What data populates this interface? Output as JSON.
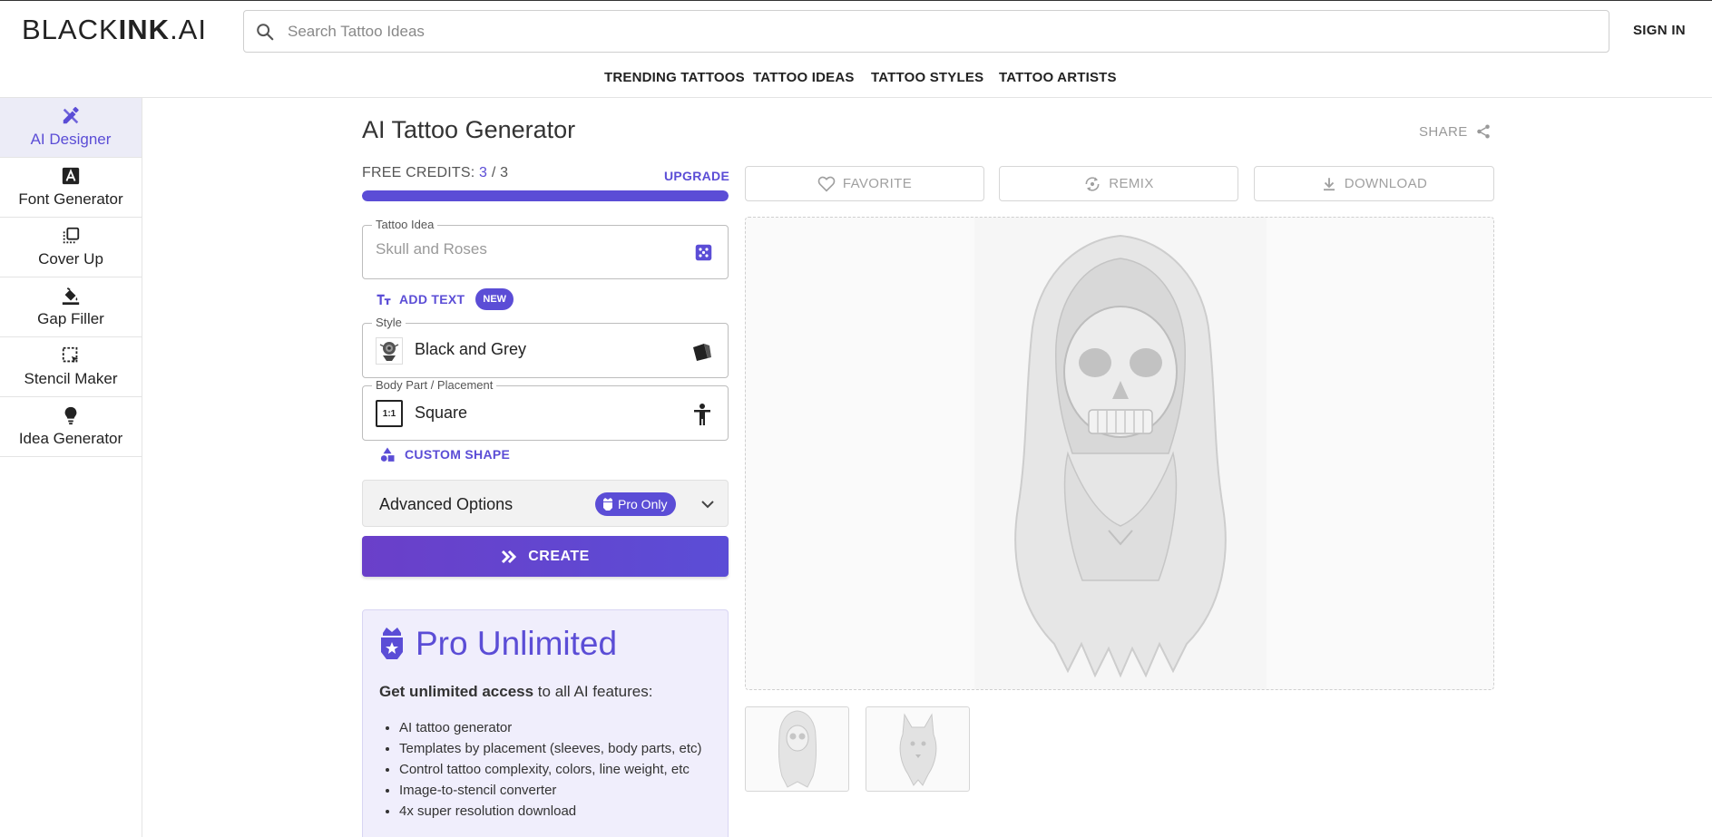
{
  "header": {
    "logo_light": "BLACK",
    "logo_bold": "INK",
    "logo_suffix": ".AI",
    "search_placeholder": "Search Tattoo Ideas",
    "sign_in": "SIGN IN"
  },
  "nav": [
    "TRENDING TATTOOS",
    "TATTOO IDEAS",
    "TATTOO STYLES",
    "TATTOO ARTISTS"
  ],
  "sidebar": {
    "items": [
      {
        "label": "AI Designer",
        "icon": "pen-ruler-icon",
        "active": true
      },
      {
        "label": "Font Generator",
        "icon": "font-a-icon"
      },
      {
        "label": "Cover Up",
        "icon": "layers-icon"
      },
      {
        "label": "Gap Filler",
        "icon": "paint-bucket-icon"
      },
      {
        "label": "Stencil Maker",
        "icon": "selection-icon"
      },
      {
        "label": "Idea Generator",
        "icon": "lightbulb-icon"
      }
    ]
  },
  "main": {
    "title": "AI Tattoo Generator",
    "share": "SHARE",
    "credits": {
      "label": "FREE CREDITS:",
      "used": "3",
      "separator": "/",
      "total": "3",
      "fill_fraction": 1.0
    },
    "upgrade": "UPGRADE",
    "tattoo_idea": {
      "label": "Tattoo Idea",
      "placeholder": "Skull and Roses"
    },
    "add_text": {
      "label": "ADD TEXT",
      "badge": "NEW"
    },
    "style": {
      "label": "Style",
      "value": "Black and Grey"
    },
    "placement": {
      "label": "Body Part / Placement",
      "value": "Square",
      "icon_text": "1:1"
    },
    "custom_shape": "CUSTOM SHAPE",
    "advanced": {
      "label": "Advanced Options",
      "badge": "Pro Only"
    },
    "create": "CREATE",
    "pro": {
      "title": "Pro Unlimited",
      "lead_bold": "Get unlimited access",
      "lead_rest": " to all AI features:",
      "features": [
        "AI tattoo generator",
        "Templates by placement (sleeves, body parts, etc)",
        "Control tattoo complexity, colors, line weight, etc",
        "Image-to-stencil converter",
        "4x super resolution download"
      ]
    },
    "actions": {
      "favorite": "FAVORITE",
      "remix": "REMIX",
      "download": "DOWNLOAD"
    }
  },
  "colors": {
    "accent": "#5b4dd6",
    "accent_light": "#f0eefc"
  }
}
